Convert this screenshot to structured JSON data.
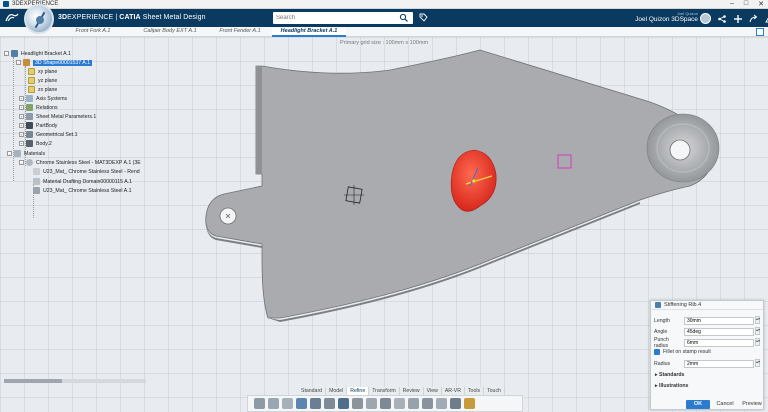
{
  "window": {
    "title": "3DEXPERIENCE",
    "controls": [
      "–",
      "□",
      "✕"
    ]
  },
  "topbar": {
    "brand_prefix": "3D",
    "brand_mid": "EXPERIENCE | ",
    "brand_app": "CATIA",
    "brand_role": " Sheet Metal Design",
    "search_placeholder": "Search",
    "user_caption": "Joel Quizon",
    "user_name": "Joel Quizon 3DSpace",
    "icons": [
      "tag-icon",
      "share-icon",
      "add-icon",
      "forward-icon",
      "help-icon"
    ]
  },
  "tabs": [
    {
      "label": "Front Fork A.1",
      "active": false
    },
    {
      "label": "Caliper Body EXT A.1",
      "active": false
    },
    {
      "label": "Front Fender A.1",
      "active": false
    },
    {
      "label": "Headlight Bracket A.1",
      "active": true
    }
  ],
  "viewport": {
    "grid_caption": "Primary grid size : 100mm x 100mm"
  },
  "tree": [
    {
      "label": "Headlight Bracket A.1",
      "level": 0,
      "icon": "product-icon",
      "expand": "-"
    },
    {
      "label": "3D Shape00001537 A.1",
      "level": 1,
      "icon": "shape-icon",
      "expand": "-",
      "selected": true
    },
    {
      "label": "xy plane",
      "level": 2,
      "icon": "plane-icon"
    },
    {
      "label": "yz plane",
      "level": 2,
      "icon": "plane-icon"
    },
    {
      "label": "zx plane",
      "level": 2,
      "icon": "plane-icon"
    },
    {
      "label": "Axis Systems",
      "level": 2,
      "icon": "axis-icon",
      "expand": "+"
    },
    {
      "label": "Relations",
      "level": 2,
      "icon": "relations-icon",
      "expand": "+"
    },
    {
      "label": "Sheet Metal Parameters.1",
      "level": 2,
      "icon": "sheetmetal-icon",
      "expand": "+"
    },
    {
      "label": "PartBody",
      "level": 2,
      "icon": "partbody-icon",
      "expand": "+"
    },
    {
      "label": "Geometrical Set.1",
      "level": 2,
      "icon": "geoset-icon",
      "expand": "+"
    },
    {
      "label": "Body.2",
      "level": 2,
      "icon": "body-icon",
      "expand": "+"
    },
    {
      "label": "Materials",
      "level": 1,
      "icon": "materials-icon",
      "expand": "-"
    },
    {
      "label": "Chrome Stainless Steel - MAT3DEXP A.1 (3E",
      "level": 2,
      "icon": "material-icon",
      "expand": "-"
    },
    {
      "label": "U23_Mat_ Chrome Stainless Steel - Rend",
      "level": 3,
      "icon": "render-icon"
    },
    {
      "label": "Material Drafting Domain00000115 A.1",
      "level": 3,
      "icon": "drafting-icon"
    },
    {
      "label": "U23_Mat_ Chrome Stainless Steel A.1",
      "level": 3,
      "icon": "material-core-icon"
    }
  ],
  "panel": {
    "title": "Stiffening Rib.4",
    "length_label": "Length",
    "length_value": "30mm",
    "angle_label": "Angle",
    "angle_value": "45deg",
    "punch_label": "Punch radius",
    "punch_value": "6mm",
    "fillet_label": "Fillet on stamp result",
    "radius_label": "Radius",
    "radius_value": "2mm",
    "standards_label": "Standards",
    "illustrations_label": "Illustrations",
    "ok_label": "OK",
    "cancel_label": "Cancel",
    "preview_label": "Preview"
  },
  "action_tabs": [
    "Standard",
    "Model",
    "Refine",
    "Transform",
    "Review",
    "View",
    "AR-VR",
    "Tools",
    "Touch"
  ],
  "action_active": "Refine",
  "colors": {
    "accent": "#2b7bd1",
    "topbar": "#0a3a5f",
    "part": "#a9abae",
    "rib": "#e8372c",
    "marker": "#d13bbd"
  }
}
